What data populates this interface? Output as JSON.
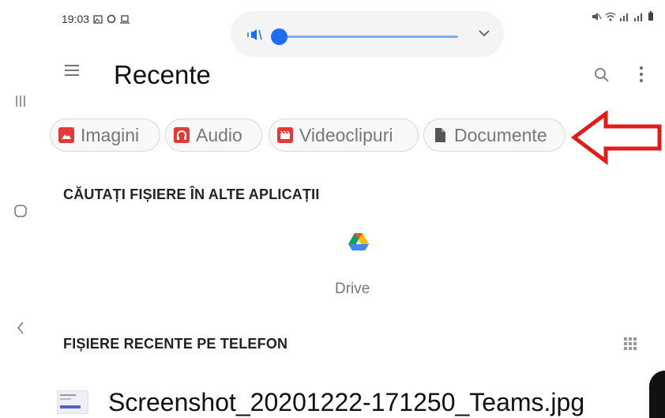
{
  "status_bar": {
    "time": "19:03"
  },
  "header": {
    "title": "Recente"
  },
  "chips": [
    {
      "label": "Imagini",
      "icon": "image-icon",
      "color": "#e53935"
    },
    {
      "label": "Audio",
      "icon": "headphones-icon",
      "color": "#e53935"
    },
    {
      "label": "Videoclipuri",
      "icon": "video-clapper-icon",
      "color": "#e53935"
    },
    {
      "label": "Documente",
      "icon": "document-icon",
      "color": "#555555"
    }
  ],
  "sections": {
    "other_apps": "CĂUTAȚI FIȘIERE ÎN ALTE APLICAȚII",
    "recent_files": "FIȘIERE RECENTE PE TELEFON"
  },
  "apps": [
    {
      "label": "Drive",
      "icon": "google-drive-icon"
    }
  ],
  "recent_files": [
    {
      "name": "Screenshot_20201222-171250_Teams.jpg"
    }
  ],
  "colors": {
    "accent": "#1e6cff",
    "annotation_arrow": "#e31b1b",
    "chip_red": "#e53935"
  }
}
